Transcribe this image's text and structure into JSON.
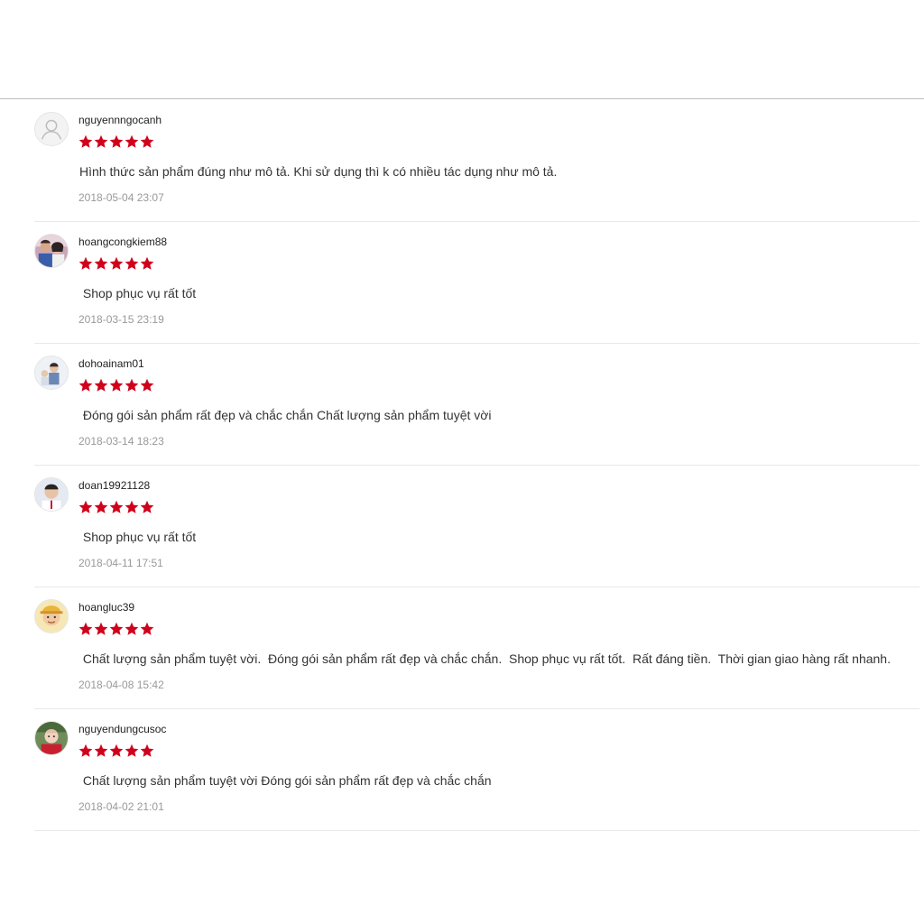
{
  "reviews": [
    {
      "username": "nguyennngocanh",
      "rating": 5,
      "comment": "Hình thức sản phẩm đúng như mô tả. Khi sử dụng thì k có nhiều tác dụng như mô tả.",
      "date": "2018-05-04 23:07",
      "avatar": "default-user-icon"
    },
    {
      "username": "hoangcongkiem88",
      "rating": 5,
      "comment": " Shop phục vụ rất tốt",
      "date": "2018-03-15 23:19",
      "avatar": "user-photo"
    },
    {
      "username": "dohoainam01",
      "rating": 5,
      "comment": " Đóng gói sản phẩm rất đẹp và chắc chắn Chất lượng sản phẩm tuyệt vời",
      "date": "2018-03-14 18:23",
      "avatar": "user-photo"
    },
    {
      "username": "doan19921128",
      "rating": 5,
      "comment": " Shop phục vụ rất tốt",
      "date": "2018-04-11 17:51",
      "avatar": "user-photo"
    },
    {
      "username": "hoangluc39",
      "rating": 5,
      "comment": " Chất lượng sản phẩm tuyệt vời.  Đóng gói sản phẩm rất đẹp và chắc chắn.  Shop phục vụ rất tốt.  Rất đáng tiền.  Thời gian giao hàng rất nhanh.",
      "date": "2018-04-08 15:42",
      "avatar": "user-photo"
    },
    {
      "username": "nguyendungcusoc",
      "rating": 5,
      "comment": " Chất lượng sản phẩm tuyệt vời Đóng gói sản phẩm rất đẹp và chắc chắn",
      "date": "2018-04-02 21:01",
      "avatar": "user-photo"
    }
  ],
  "colors": {
    "star": "#d0011b",
    "divider": "#e8e8e8",
    "timestamp": "#999999"
  }
}
